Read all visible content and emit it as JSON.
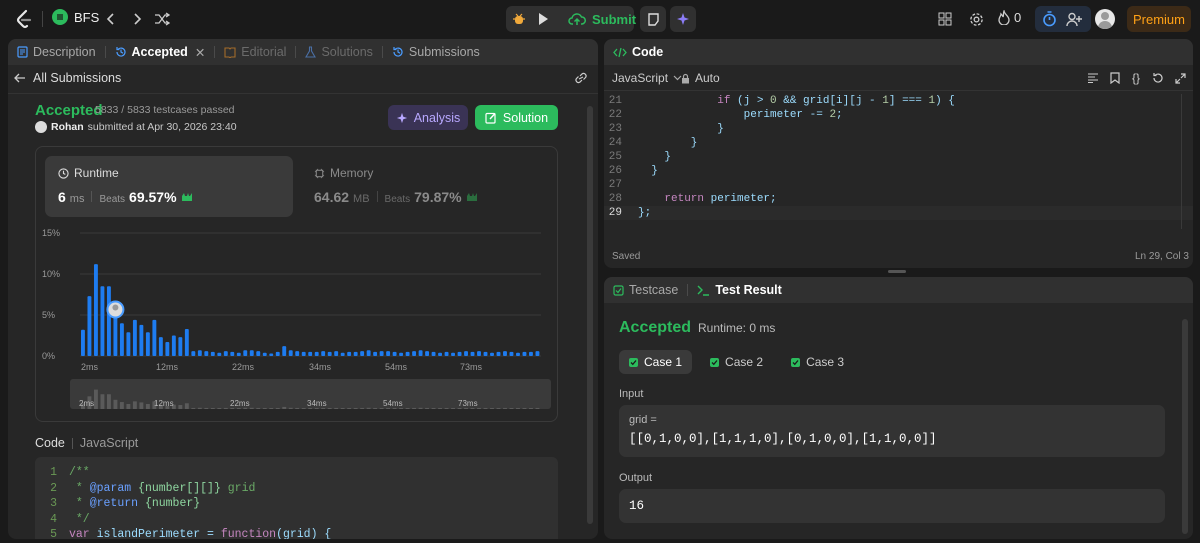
{
  "topbar": {
    "problem_list_label": "BFS",
    "submit_label": "Submit",
    "streak_count": "0",
    "premium_label": "Premium"
  },
  "left_tabs": {
    "description": "Description",
    "accepted": "Accepted",
    "editorial": "Editorial",
    "solutions": "Solutions",
    "submissions": "Submissions"
  },
  "all_submissions": "All Submissions",
  "result": {
    "status": "Accepted",
    "testcases": "5833 / 5833 testcases passed",
    "user": "Rohan",
    "submitted": "submitted at Apr 30, 2026 23:40",
    "analysis_label": "Analysis",
    "solution_label": "Solution"
  },
  "runtime": {
    "label": "Runtime",
    "value": "6",
    "unit": "ms",
    "beats_label": "Beats",
    "beats_value": "69.57%"
  },
  "memory": {
    "label": "Memory",
    "value": "64.62",
    "unit": "MB",
    "beats_label": "Beats",
    "beats_value": "79.87%"
  },
  "chart_data": {
    "type": "bar",
    "y_ticks": [
      "15%",
      "10%",
      "5%",
      "0%"
    ],
    "ylim": [
      0,
      15
    ],
    "x_tick_labels": [
      "2ms",
      "12ms",
      "22ms",
      "34ms",
      "54ms",
      "73ms"
    ],
    "values": [
      3.2,
      7.3,
      11.2,
      8.5,
      8.5,
      5.3,
      4.0,
      2.9,
      4.4,
      3.8,
      2.9,
      4.4,
      2.3,
      1.7,
      2.5,
      2.3,
      3.3,
      0.6,
      0.7,
      0.6,
      0.5,
      0.4,
      0.6,
      0.5,
      0.4,
      0.7,
      0.7,
      0.6,
      0.4,
      0.3,
      0.5,
      1.2,
      0.7,
      0.6,
      0.5,
      0.5,
      0.5,
      0.6,
      0.5,
      0.6,
      0.4,
      0.5,
      0.5,
      0.6,
      0.7,
      0.5,
      0.6,
      0.6,
      0.5,
      0.4,
      0.5,
      0.6,
      0.7,
      0.6,
      0.5,
      0.4,
      0.5,
      0.4,
      0.5,
      0.6,
      0.5,
      0.6,
      0.5,
      0.4,
      0.5,
      0.6,
      0.5,
      0.4,
      0.5,
      0.5,
      0.6
    ],
    "highlight_index": 5
  },
  "code_section": {
    "label": "Code",
    "language": "JavaScript",
    "lines": [
      {
        "n": "1",
        "t": "/**"
      },
      {
        "n": "2",
        "t": " * @param {number[][]} grid"
      },
      {
        "n": "3",
        "t": " * @return {number}"
      },
      {
        "n": "4",
        "t": " */"
      },
      {
        "n": "5",
        "t": "var islandPerimeter = function(grid) {"
      }
    ]
  },
  "editor": {
    "title": "Code",
    "language": "JavaScript",
    "mode": "Auto",
    "saved": "Saved",
    "position": "Ln 29, Col 3",
    "lines": [
      {
        "n": "21",
        "t": "            if (j > 0 && grid[i][j - 1] === 1) {"
      },
      {
        "n": "22",
        "t": "                perimeter -= 2;"
      },
      {
        "n": "23",
        "t": "            }"
      },
      {
        "n": "24",
        "t": "        }"
      },
      {
        "n": "25",
        "t": "    }"
      },
      {
        "n": "26",
        "t": "  }"
      },
      {
        "n": "27",
        "t": ""
      },
      {
        "n": "28",
        "t": "    return perimeter;"
      },
      {
        "n": "29",
        "t": "};"
      }
    ]
  },
  "testpanel": {
    "testcase_tab": "Testcase",
    "result_tab": "Test Result",
    "status": "Accepted",
    "runtime": "Runtime: 0 ms",
    "cases": [
      "Case 1",
      "Case 2",
      "Case 3"
    ],
    "input_label": "Input",
    "input_name": "grid =",
    "input_value": "[[0,1,0,0],[1,1,1,0],[0,1,0,0],[1,1,0,0]]",
    "output_label": "Output",
    "output_value": "16"
  }
}
